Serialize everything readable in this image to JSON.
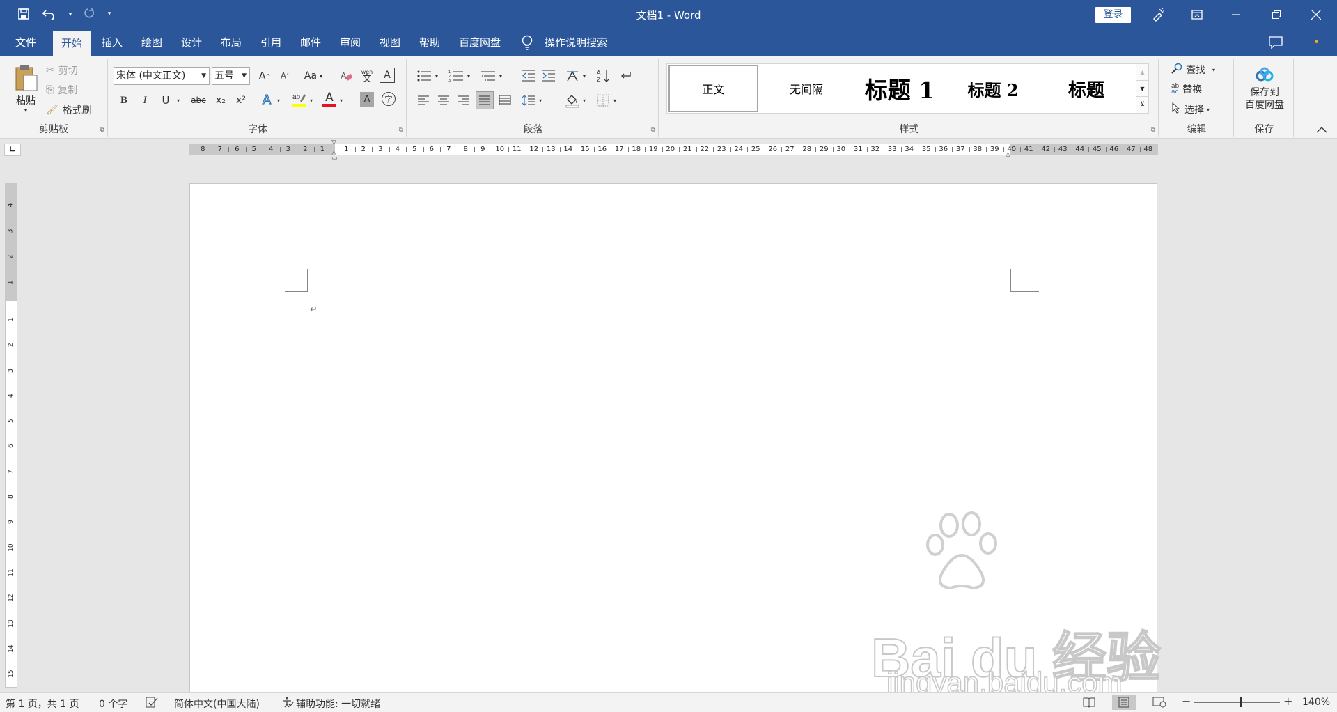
{
  "titlebar": {
    "title": "文档1  -  Word",
    "login_label": "登录"
  },
  "tabs": [
    "文件",
    "开始",
    "插入",
    "绘图",
    "设计",
    "布局",
    "引用",
    "邮件",
    "审阅",
    "视图",
    "帮助",
    "百度网盘"
  ],
  "tell_me": "操作说明搜索",
  "clipboard": {
    "paste": "粘贴",
    "cut": "剪切",
    "copy": "复制",
    "format_painter": "格式刷",
    "label": "剪贴板"
  },
  "font": {
    "name": "宋体 (中文正文)",
    "size": "五号",
    "label": "字体",
    "bold": "B",
    "italic": "I",
    "underline": "U",
    "strike": "abc",
    "sub": "x₂",
    "sup": "x²",
    "grow": "A",
    "shrink": "A",
    "change_case": "Aa",
    "char_border": "A",
    "char_shading": "A",
    "font_color": "A",
    "text_effect": "A",
    "enclose": "字",
    "phonetic": "文"
  },
  "paragraph": {
    "label": "段落"
  },
  "styles": {
    "label": "样式",
    "items": [
      "正文",
      "无间隔",
      "标题 1",
      "标题 2",
      "标题"
    ]
  },
  "editing": {
    "label": "编辑",
    "find": "查找",
    "replace": "替换",
    "select": "选择"
  },
  "save": {
    "label": "保存",
    "button": "保存到\n百度网盘"
  },
  "ruler": {
    "left_numbers": [
      "8",
      "7",
      "6",
      "5",
      "4",
      "3",
      "2",
      "1"
    ],
    "right_numbers": [
      "1",
      "2",
      "3",
      "4",
      "5",
      "6",
      "7",
      "8",
      "9",
      "10",
      "11",
      "12",
      "13",
      "14",
      "15",
      "16",
      "17",
      "18",
      "19",
      "20",
      "21",
      "22",
      "23",
      "24",
      "25",
      "26",
      "27",
      "28",
      "29",
      "30",
      "31",
      "32",
      "33",
      "34",
      "35",
      "36",
      "37",
      "38",
      "39",
      "40",
      "41",
      "42",
      "43",
      "44",
      "45",
      "46",
      "47",
      "48"
    ],
    "v_top": [
      "4",
      "3",
      "2",
      "1"
    ],
    "v_bottom": [
      "1",
      "2",
      "3",
      "4",
      "5",
      "6",
      "7",
      "8",
      "9",
      "10",
      "11",
      "12",
      "13",
      "14",
      "15"
    ]
  },
  "status": {
    "page": "第 1 页，共 1 页",
    "words": "0 个字",
    "language": "简体中文(中国大陆)",
    "accessibility": "辅助功能: 一切就绪",
    "zoom": "140%",
    "zoom_level_percent": 140
  },
  "watermark": {
    "brand": "Bai du 经验",
    "url": "jingyan.baidu.com"
  },
  "colors": {
    "accent": "#2b579a",
    "highlight": "#ffff00",
    "font_color": "#e81123"
  }
}
